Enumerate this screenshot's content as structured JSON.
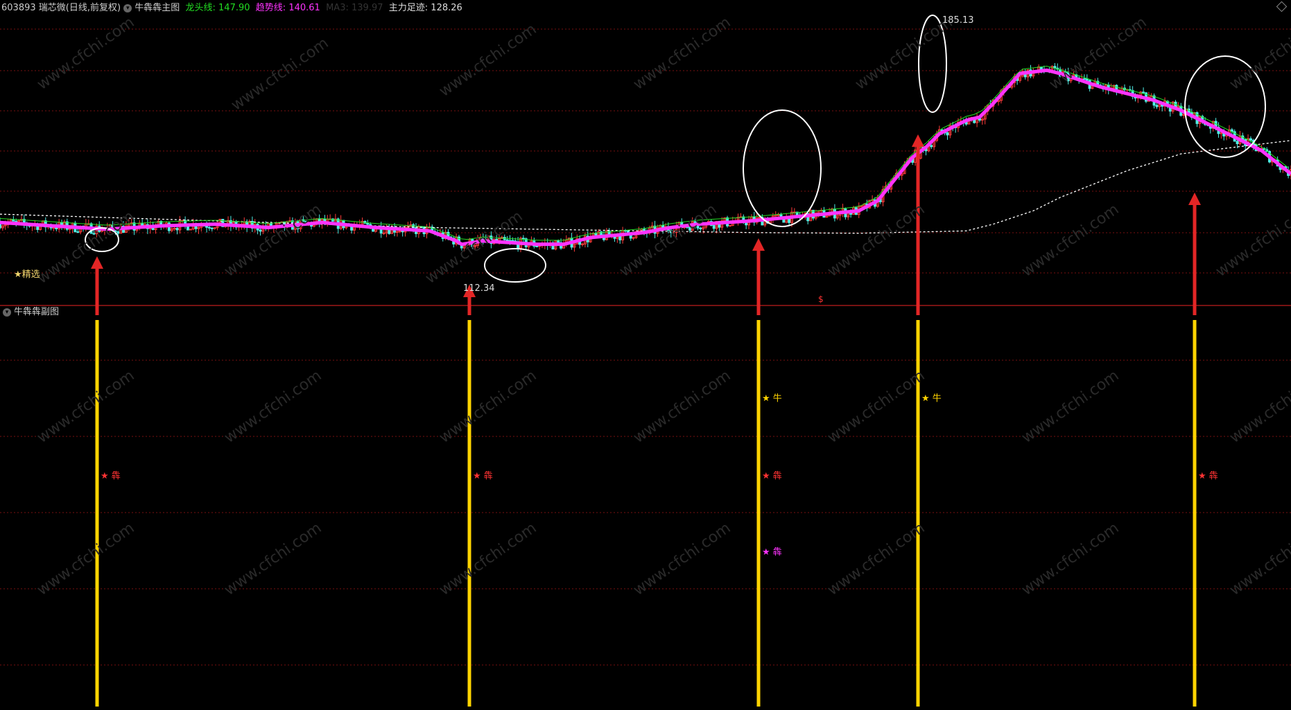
{
  "header": {
    "code": "603893",
    "name": "瑞芯微",
    "period": "(日线,前复权)",
    "indicator": "牛犇犇主图",
    "line1_label": "龙头线:",
    "line1_value": "147.90",
    "line2_label": "趋势线:",
    "line2_value": "140.61",
    "line3_label": "MA3:",
    "line3_value": "139.97",
    "line4_label": "主力足迹:",
    "line4_value": "128.26"
  },
  "sub_panel": {
    "title": "牛犇犇副图"
  },
  "colors": {
    "background": "#000000",
    "up_candle": "#ff3b3b",
    "down_candle": "#4ff0e6",
    "trend_line": "#ff33ff",
    "leader_line": "#22dd22",
    "footprint_line": "#ffffff",
    "arrow": "#e32626",
    "signal_bar": "#ffd400",
    "grid": "#7a1010"
  },
  "chart_data": [
    {
      "type": "candlestick",
      "title": "牛犇犇主图",
      "ylim": [
        108,
        192
      ],
      "annotations": {
        "selected_label": "★精选",
        "low_label": "112.34",
        "high_label": "185.13",
        "marker_label": "$"
      },
      "series": [
        {
          "name": "主力足迹",
          "x": [
            0,
            40,
            80,
            120,
            160,
            200,
            240,
            280,
            320,
            360,
            370,
            385,
            395,
            420,
            440,
            460,
            481
          ],
          "values": [
            133,
            132,
            131,
            130,
            129,
            128.5,
            128,
            127.5,
            127.3,
            128,
            130,
            134,
            138,
            146,
            151,
            153,
            155
          ]
        },
        {
          "name": "趋势线",
          "x": [
            0,
            20,
            40,
            60,
            80,
            100,
            120,
            140,
            160,
            170,
            172,
            180,
            190,
            200,
            210,
            220,
            240,
            250,
            260,
            280,
            300,
            320,
            327,
            330,
            340,
            345,
            350,
            360,
            365,
            370,
            380,
            390,
            395,
            410,
            420,
            430,
            440,
            460,
            470,
            481
          ],
          "values": [
            130.5,
            129.5,
            128.5,
            129.5,
            130,
            129,
            130.5,
            129,
            128,
            125,
            124,
            125,
            124.5,
            124,
            124,
            126,
            127.5,
            129,
            130,
            131,
            132.5,
            134,
            137,
            140,
            150,
            153,
            157,
            161,
            162,
            166,
            175,
            176,
            175,
            171,
            169,
            167,
            164,
            156,
            152,
            145
          ]
        }
      ],
      "leader_line_note": "龙头线"
    },
    {
      "type": "bar",
      "title": "牛犇犇副图",
      "categories": [
        "118",
        "569",
        "921",
        "1114",
        "1451"
      ],
      "values": [
        1,
        1,
        1,
        1,
        1
      ],
      "signals": [
        {
          "x": "118",
          "labels": [
            "★ 犇"
          ],
          "label_colors": [
            "#ff3333"
          ]
        },
        {
          "x": "569",
          "labels": [
            "★ 犇"
          ],
          "label_colors": [
            "#ff3333"
          ]
        },
        {
          "x": "921",
          "labels": [
            "★ 牛",
            "★ 犇",
            "★ 犇"
          ],
          "label_colors": [
            "#ffd400",
            "#ff3333",
            "#ff33ff"
          ]
        },
        {
          "x": "1114",
          "labels": [
            "★ 牛"
          ],
          "label_colors": [
            "#ffd400"
          ]
        },
        {
          "x": "1451",
          "labels": [
            "★ 犇"
          ],
          "label_colors": [
            "#ff3333"
          ]
        }
      ]
    }
  ],
  "watermark": "www.cfchi.com"
}
